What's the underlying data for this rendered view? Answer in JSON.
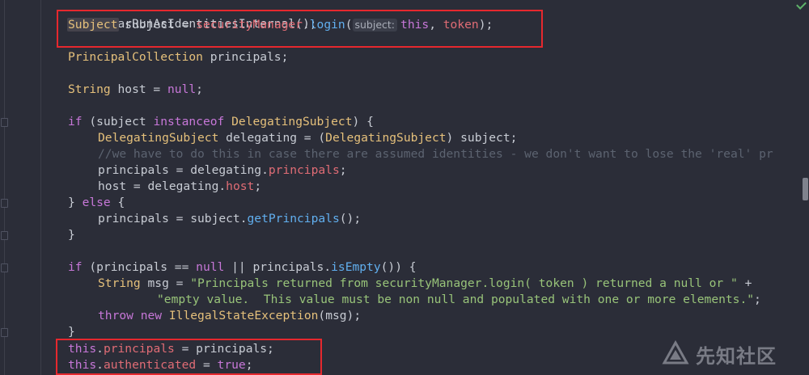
{
  "editor": {
    "hint": {
      "param": "subject:"
    },
    "lines": {
      "l0": "clearRunAsIdentitiesInternal();",
      "l1a": "Subject",
      "l1b": " subject = ",
      "l1c": "securityManager",
      "l1d": ".",
      "l1e": "login",
      "l1f": "(",
      "l1g": "this",
      "l1h": ", ",
      "l1i": "token",
      "l1j": ");",
      "l2a": "PrincipalCollection",
      "l2b": " principals;",
      "l3a": "String",
      "l3b": " host = ",
      "l3c": "null",
      "l3d": ";",
      "l4a": "if",
      "l4b": " (subject ",
      "l4c": "instanceof",
      "l4d": " ",
      "l4e": "DelegatingSubject",
      "l4f": ") {",
      "l5a": "DelegatingSubject",
      "l5b": " delegating = (",
      "l5c": "DelegatingSubject",
      "l5d": ") subject;",
      "l6": "//we have to do this in case there are assumed identities - we don't want to lose the 'real' pr",
      "l7a": "principals = delegating.",
      "l7b": "principals",
      "l7c": ";",
      "l8a": "host = delegating.",
      "l8b": "host",
      "l8c": ";",
      "l9a": "} ",
      "l9b": "else",
      "l9c": " {",
      "l10a": "principals = subject.",
      "l10b": "getPrincipals",
      "l10c": "();",
      "l11": "}",
      "l12a": "if",
      "l12b": " (principals == ",
      "l12c": "null",
      "l12d": " || principals.",
      "l12e": "isEmpty",
      "l12f": "()) {",
      "l13a": "String",
      "l13b": " msg = ",
      "l13c": "\"Principals returned from securityManager.login( token ) returned a null or \"",
      "l13d": " +",
      "l14a": "\"empty value.  This value must be non null and populated with one or more elements.\"",
      "l14b": ";",
      "l15a": "throw",
      "l15b": " ",
      "l15c": "new",
      "l15d": " ",
      "l15e": "IllegalStateException",
      "l15f": "(msg);",
      "l16": "}",
      "l17a": "this",
      "l17b": ".",
      "l17c": "principals",
      "l17d": " = principals;",
      "l18a": "this",
      "l18b": ".",
      "l18c": "authenticated",
      "l18d": " = ",
      "l18e": "true",
      "l18f": ";"
    }
  },
  "watermark": {
    "text": "先知社区"
  },
  "colors": {
    "background": "#2b2d38",
    "keyword": "#c777d8",
    "type": "#e5c07b",
    "method": "#61afef",
    "field": "#e06c75",
    "string": "#98c379",
    "comment": "#5c6370",
    "annotation_box": "#e6282e"
  },
  "icons": {
    "status": "check-icon",
    "watermark": "watermark-logo-icon"
  }
}
